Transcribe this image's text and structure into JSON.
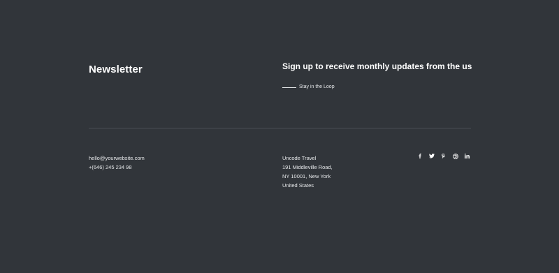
{
  "newsletter": {
    "title": "Newsletter",
    "heading": "Sign up to receive monthly updates from the us",
    "tagline": "Stay in the Loop"
  },
  "contact": {
    "email": "hello@yourwebsite.com",
    "phone": "+(646) 245 234 98"
  },
  "address": {
    "lines": [
      "Uncode Travel",
      "191 Middleville Road,",
      "NY 10001, New York",
      "United States"
    ]
  },
  "social": {
    "icons": [
      "facebook-icon",
      "twitter-icon",
      "pinterest-icon",
      "dribbble-icon",
      "linkedin-icon"
    ]
  },
  "colors": {
    "background": "#31353a",
    "text": "#ffffff",
    "muted_text": "#e6e8ea",
    "divider": "#4a4f55"
  }
}
